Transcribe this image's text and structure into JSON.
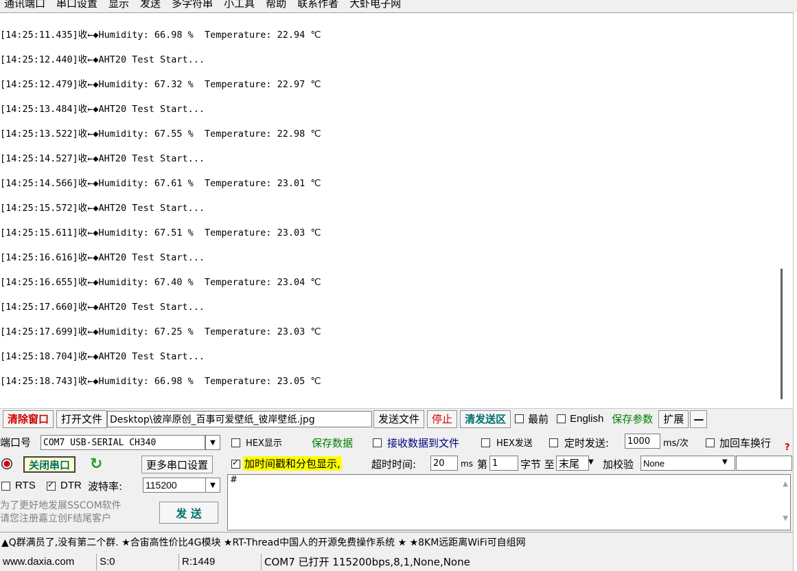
{
  "menu": [
    "通讯端口",
    "串口设置",
    "显示",
    "发送",
    "多字符串",
    "小工具",
    "帮助",
    "联系作者",
    "大虾电子网"
  ],
  "receive_lines": [
    "[14:25:11.435]收←◆Humidity: 66.98 %  Temperature: 22.94 ℃",
    "[14:25:12.440]收←◆AHT20 Test Start...",
    "[14:25:12.479]收←◆Humidity: 67.32 %  Temperature: 22.97 ℃",
    "[14:25:13.484]收←◆AHT20 Test Start...",
    "[14:25:13.522]收←◆Humidity: 67.55 %  Temperature: 22.98 ℃",
    "[14:25:14.527]收←◆AHT20 Test Start...",
    "[14:25:14.566]收←◆Humidity: 67.61 %  Temperature: 23.01 ℃",
    "[14:25:15.572]收←◆AHT20 Test Start...",
    "[14:25:15.611]收←◆Humidity: 67.51 %  Temperature: 23.03 ℃",
    "[14:25:16.616]收←◆AHT20 Test Start...",
    "[14:25:16.655]收←◆Humidity: 67.40 %  Temperature: 23.04 ℃",
    "[14:25:17.660]收←◆AHT20 Test Start...",
    "[14:25:17.699]收←◆Humidity: 67.25 %  Temperature: 23.03 ℃",
    "[14:25:18.704]收←◆AHT20 Test Start...",
    "[14:25:18.743]收←◆Humidity: 66.98 %  Temperature: 23.05 ℃"
  ],
  "toolbar": {
    "clear_window": "清除窗口",
    "open_file": "打开文件",
    "file_path": "Desktop\\彼岸原创_百事可爱壁纸_彼岸壁纸.jpg",
    "send_file": "发送文件",
    "stop": "停止",
    "clear_send": "清发送区",
    "topmost": "最前",
    "english": "English",
    "save_params": "保存参数",
    "expand": "扩展",
    "collapse": "—"
  },
  "port": {
    "port_label": "端口号",
    "port_value": "COM7 USB-SERIAL CH340",
    "close_port": "关闭串口",
    "more_settings": "更多串口设置",
    "rts_label": "RTS",
    "dtr_label": "DTR",
    "baud_label": "波特率:",
    "baud_value": "115200",
    "promo_line1": "为了更好地发展SSCOM软件",
    "promo_line2": "请您注册嘉立创F结尾客户",
    "send_button": "发 送"
  },
  "options": {
    "hex_display": "HEX显示",
    "save_data": "保存数据",
    "recv_to_file": "接收数据到文件",
    "hex_send": "HEX发送",
    "timed_send": "定时发送:",
    "interval_value": "1000",
    "interval_unit": "ms/次",
    "add_crlf": "加回车换行",
    "timestamp": "加时间戳和分包显示,",
    "timeout_label": "超时时间:",
    "timeout_value": "20",
    "timeout_unit": "ms",
    "byte_prefix": "第",
    "byte_value": "1",
    "byte_to": "字节 至",
    "byte_end": "末尾",
    "checksum_label": "加校验",
    "checksum_value": "None"
  },
  "send_area": {
    "text": "#"
  },
  "ticker": "▲Q群满员了,没有第二个群. ★合宙高性价比4G模块 ★RT-Thread中国人的开源免费操作系统 ★ ★8KM远距离WiFi可自组网",
  "status": {
    "website": "www.daxia.com",
    "sent": "S:0",
    "received": "R:1449",
    "port_status": "COM7 已打开  115200bps,8,1,None,None"
  },
  "colors": {
    "accent_red": "#d00000",
    "accent_green": "#008000",
    "highlight": "#ffff00"
  }
}
